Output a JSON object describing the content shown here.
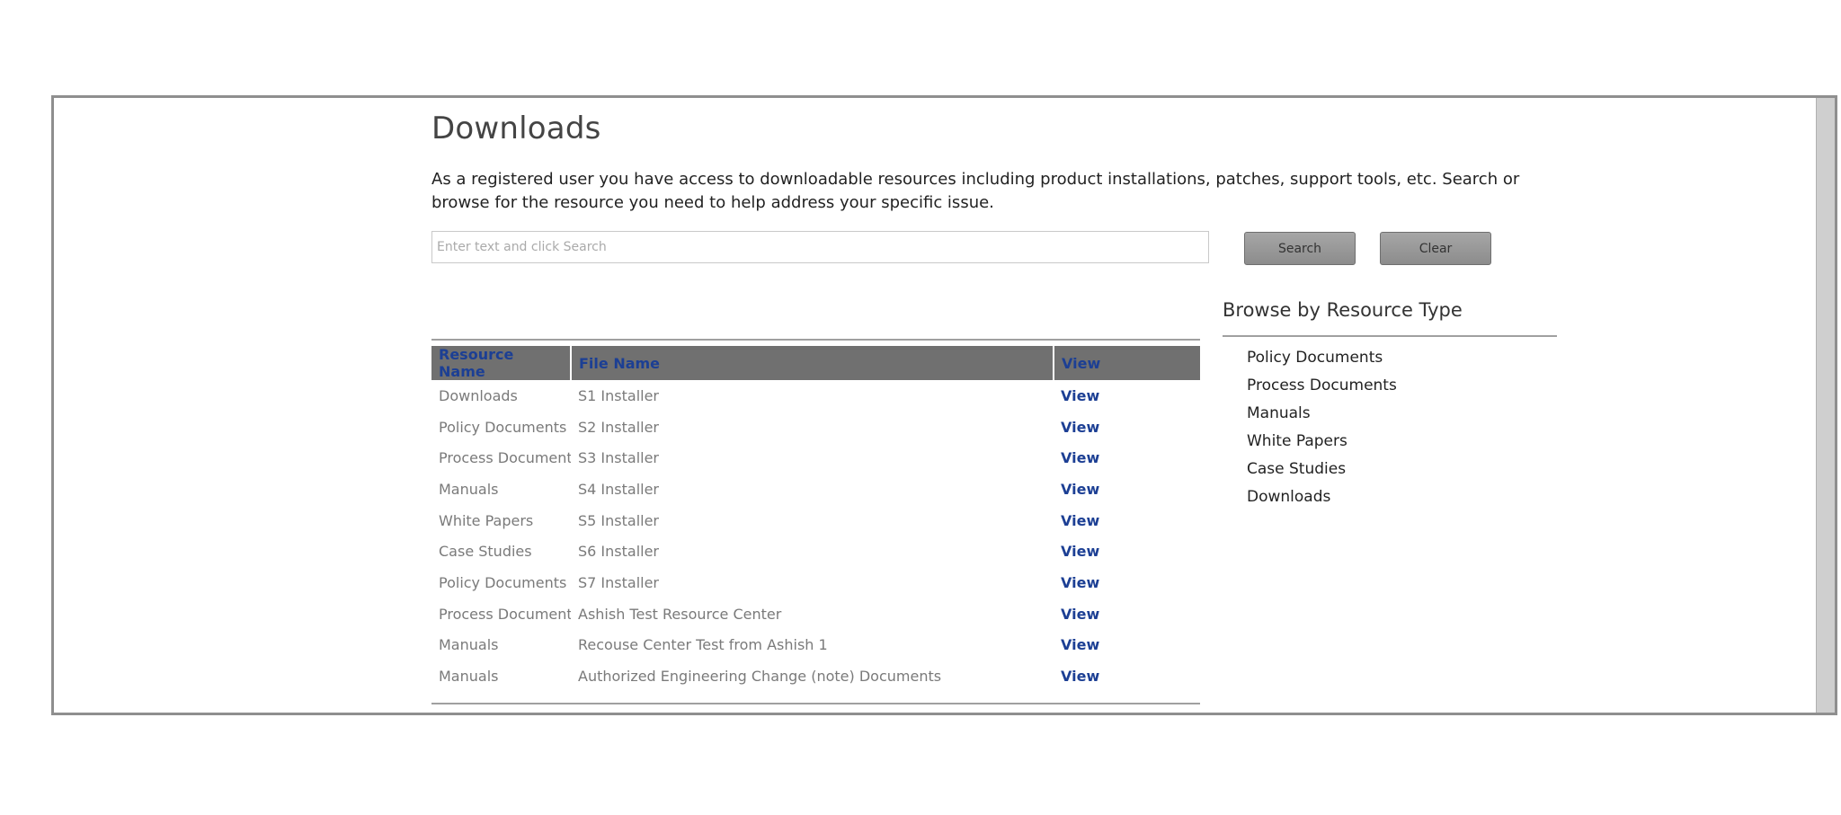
{
  "page": {
    "title": "Downloads",
    "intro": "As a registered user you have access to downloadable resources including product installations, patches, support tools, etc. Search or browse for the resource you need to help address your specific issue."
  },
  "search": {
    "placeholder": "Enter text and click Search",
    "value": "",
    "search_label": "Search",
    "clear_label": "Clear"
  },
  "table": {
    "headers": {
      "resource_name": "Resource Name",
      "file_name": "File Name",
      "view": "View"
    },
    "rows": [
      {
        "resource": "Downloads",
        "file": "S1 Installer",
        "view": "View"
      },
      {
        "resource": "Policy Documents",
        "file": "S2 Installer",
        "view": "View"
      },
      {
        "resource": "Process Documents",
        "file": "S3 Installer",
        "view": "View"
      },
      {
        "resource": "Manuals",
        "file": "S4 Installer",
        "view": "View"
      },
      {
        "resource": "White Papers",
        "file": "S5 Installer",
        "view": "View"
      },
      {
        "resource": "Case Studies",
        "file": "S6 Installer",
        "view": "View"
      },
      {
        "resource": "Policy Documents",
        "file": "S7 Installer",
        "view": "View"
      },
      {
        "resource": "Process Documents",
        "file": "Ashish Test Resource Center",
        "view": "View"
      },
      {
        "resource": "Manuals",
        "file": "Recouse Center Test from Ashish 1",
        "view": "View"
      },
      {
        "resource": "Manuals",
        "file": "Authorized Engineering Change (note) Documents",
        "view": "View"
      }
    ]
  },
  "browse": {
    "title": "Browse by Resource Type",
    "items": [
      "Policy Documents",
      "Process Documents",
      "Manuals",
      "White Papers",
      "Case Studies",
      "Downloads"
    ]
  },
  "colors": {
    "header_bg": "#707070",
    "link_blue": "#1c3f94",
    "button_gray": "#999999"
  }
}
